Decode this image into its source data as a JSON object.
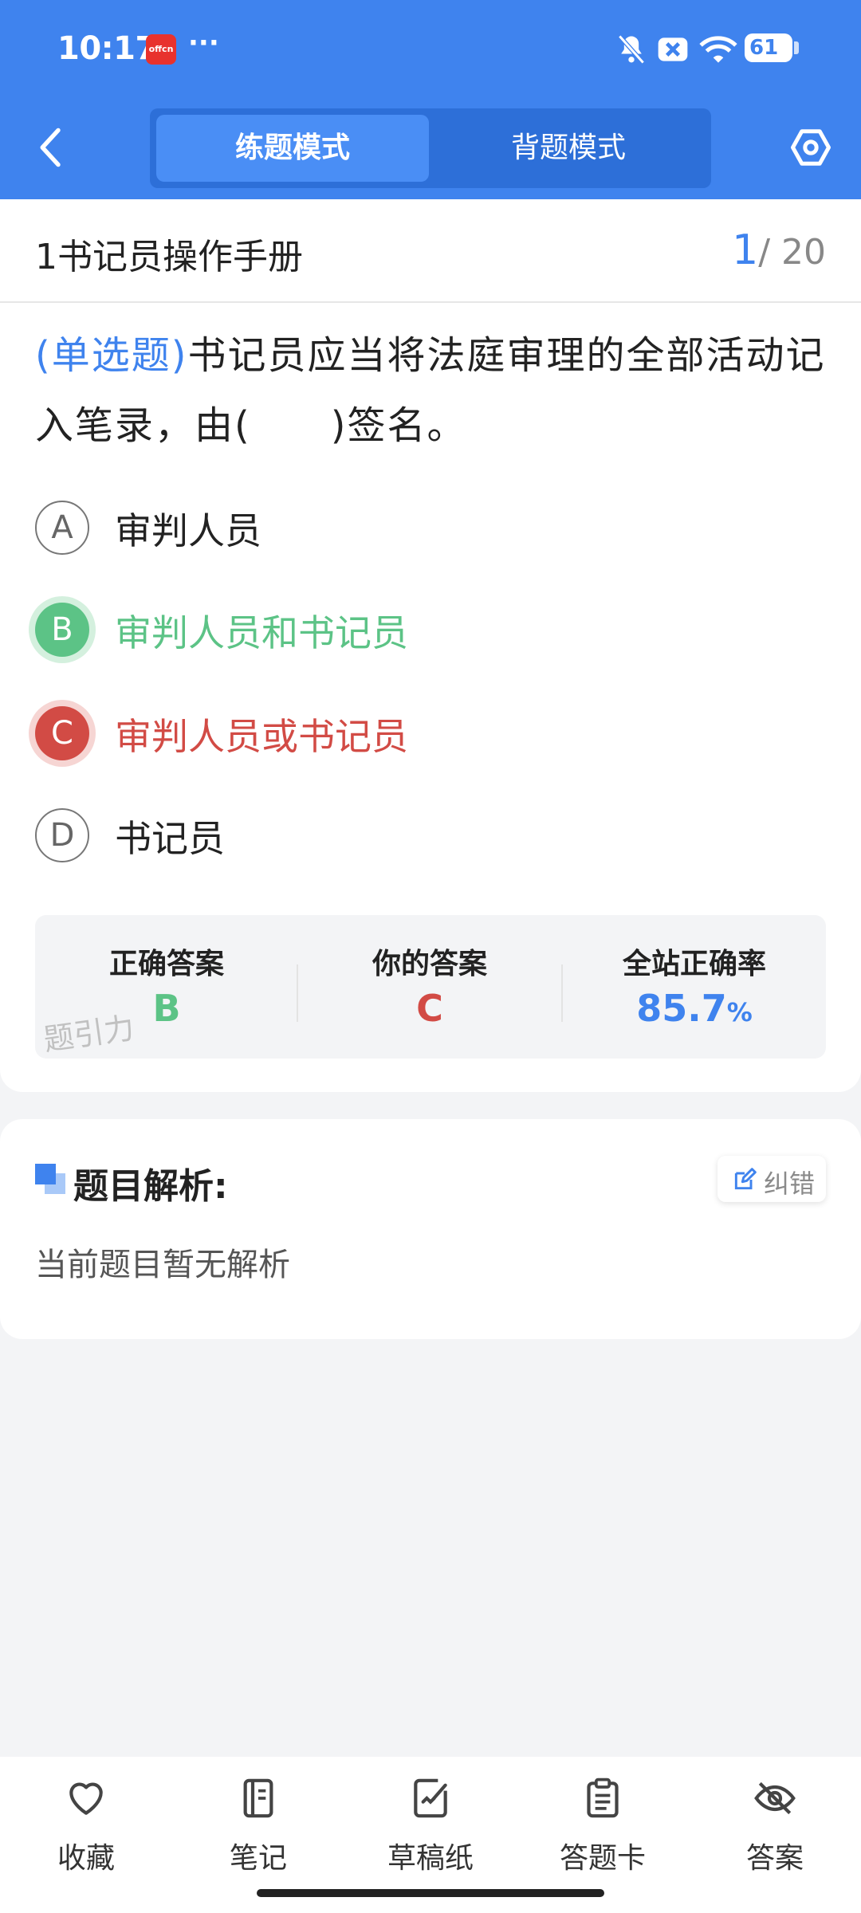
{
  "status": {
    "time": "10:17",
    "app_badge": "offcn",
    "more": "···",
    "battery": "61"
  },
  "header": {
    "tabs": [
      {
        "label": "练题模式",
        "active": true
      },
      {
        "label": "背题模式",
        "active": false
      }
    ]
  },
  "question": {
    "chapter_title": "1书记员操作手册",
    "current": "1",
    "total": "/ 20",
    "type": "(单选题)",
    "text": "书记员应当将法庭审理的全部活动记入笔录，由(　　)签名。",
    "options": [
      {
        "letter": "A",
        "text": "审判人员",
        "state": "normal"
      },
      {
        "letter": "B",
        "text": "审判人员和书记员",
        "state": "correct"
      },
      {
        "letter": "C",
        "text": "审判人员或书记员",
        "state": "wrong"
      },
      {
        "letter": "D",
        "text": "书记员",
        "state": "normal"
      }
    ]
  },
  "answer": {
    "correct_label": "正确答案",
    "correct_value": "B",
    "yours_label": "你的答案",
    "yours_value": "C",
    "rate_label": "全站正确率",
    "rate_value": "85.7",
    "rate_unit": "%",
    "watermark": "题引力"
  },
  "analysis": {
    "title": "题目解析:",
    "fix_label": "纠错",
    "content": "当前题目暂无解析"
  },
  "bottom_nav": [
    {
      "label": "收藏",
      "icon": "heart-icon"
    },
    {
      "label": "笔记",
      "icon": "notebook-icon"
    },
    {
      "label": "草稿纸",
      "icon": "draft-icon"
    },
    {
      "label": "答题卡",
      "icon": "answer-card-icon"
    },
    {
      "label": "答案",
      "icon": "eye-off-icon"
    }
  ],
  "colors": {
    "primary": "#3f83ee",
    "correct": "#5cc386",
    "wrong": "#d24b45"
  }
}
